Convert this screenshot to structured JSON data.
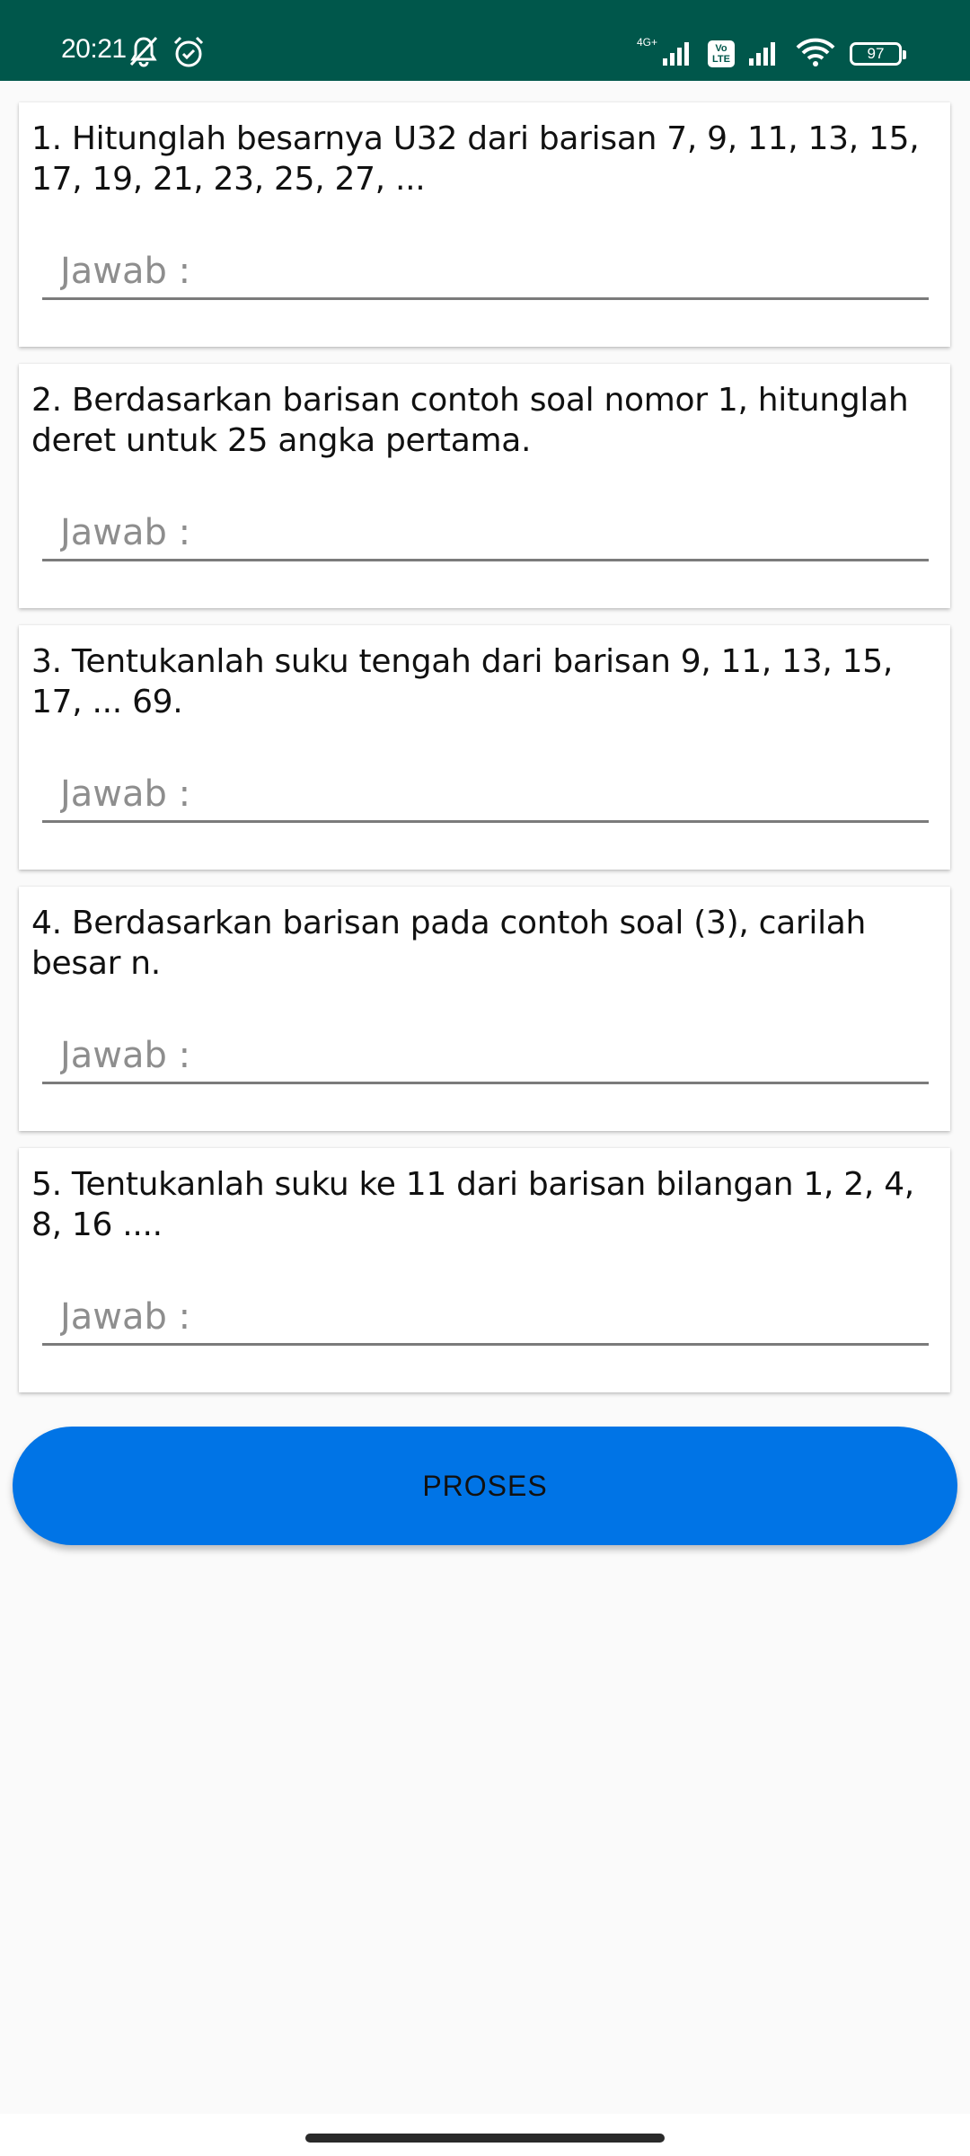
{
  "status_bar": {
    "time": "20:21",
    "battery": "97",
    "network_label": "4G+",
    "volte_top": "Vo",
    "volte_bottom": "LTE",
    "icons": [
      "muted-bell-icon",
      "alarm-icon",
      "signal-icon",
      "volte-icon",
      "signal-icon",
      "wifi-icon",
      "battery-icon"
    ]
  },
  "questions": [
    {
      "text": "1. Hitunglah besarnya U32 dari barisan 7, 9, 11, 13, 15, 17, 19, 21, 23, 25, 27, ...",
      "placeholder": "Jawab :"
    },
    {
      "text": "2. Berdasarkan barisan contoh soal nomor 1, hitunglah deret untuk 25 angka pertama.",
      "placeholder": "Jawab :"
    },
    {
      "text": "3. Tentukanlah suku tengah dari barisan 9, 11, 13, 15, 17, ... 69.",
      "placeholder": "Jawab :"
    },
    {
      "text": "4. Berdasarkan barisan pada contoh soal (3), carilah besar n.",
      "placeholder": "Jawab :"
    },
    {
      "text": "5. Tentukanlah suku ke 11 dari barisan bilangan 1, 2, 4, 8, 16 ....",
      "placeholder": "Jawab :"
    }
  ],
  "button": {
    "label": "PROSES"
  },
  "colors": {
    "status_bar": "#00574b",
    "button": "#0074e6",
    "background": "#fafafa"
  }
}
